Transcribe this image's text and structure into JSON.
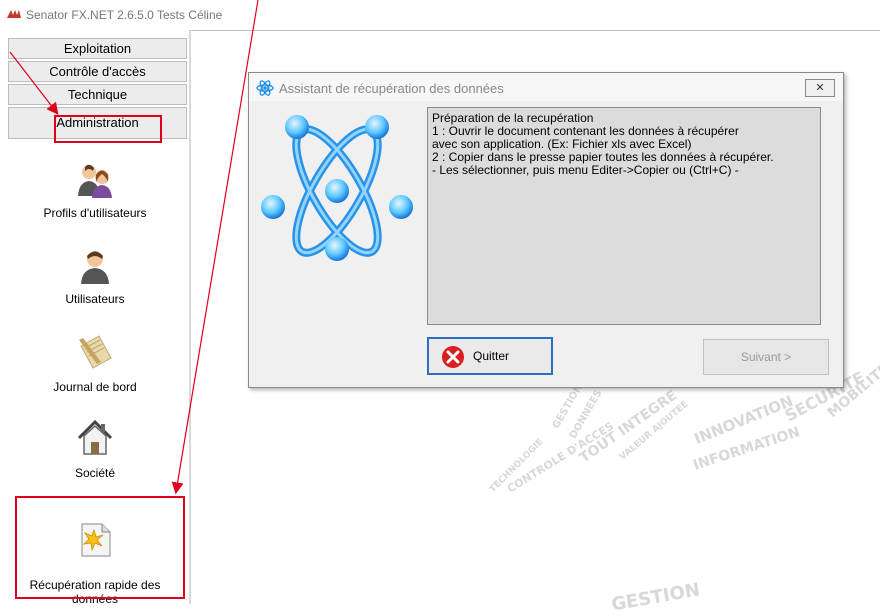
{
  "window": {
    "title": "Senator FX.NET 2.6.5.0 Tests Céline"
  },
  "nav": {
    "buttons": [
      {
        "label": "Exploitation"
      },
      {
        "label": "Contrôle d'accès"
      },
      {
        "label": "Technique"
      },
      {
        "label": "Administration"
      }
    ]
  },
  "modules": [
    {
      "label": "Profils d'utilisateurs",
      "icon": "users-group-icon"
    },
    {
      "label": "Utilisateurs",
      "icon": "user-icon"
    },
    {
      "label": "Journal de bord",
      "icon": "notebook-pen-icon"
    },
    {
      "label": "Société",
      "icon": "house-icon"
    },
    {
      "label": "Récupération rapide des\ndonnées",
      "icon": "import-document-icon"
    }
  ],
  "dialog": {
    "title": "Assistant de récupération des données",
    "close_label": "✕",
    "instructions": "Préparation de la recupération\n 1 : Ouvrir le document contenant les données à récupérer\navec son application. (Ex: Fichier xls avec Excel)\n2 : Copier dans le presse papier toutes les données à récupérer.\n - Les sélectionner, puis menu Editer->Copier ou (Ctrl+C) -",
    "quit_label": "Quitter",
    "next_label": "Suivant >"
  },
  "watermark": {
    "words": [
      "SECURITE",
      "MOBILITE",
      "INNOVATION",
      "INFORMATION",
      "TOUT INTEGRE",
      "CONTROLE D'ACCES",
      "GESTION",
      "DONNEES",
      "TECHNOLOGIE",
      "VALEUR AJOUTEE",
      "GESTION"
    ]
  },
  "colors": {
    "highlight": "#e0001b",
    "accent": "#2a6fc4",
    "atom": "#1e8fe8"
  }
}
